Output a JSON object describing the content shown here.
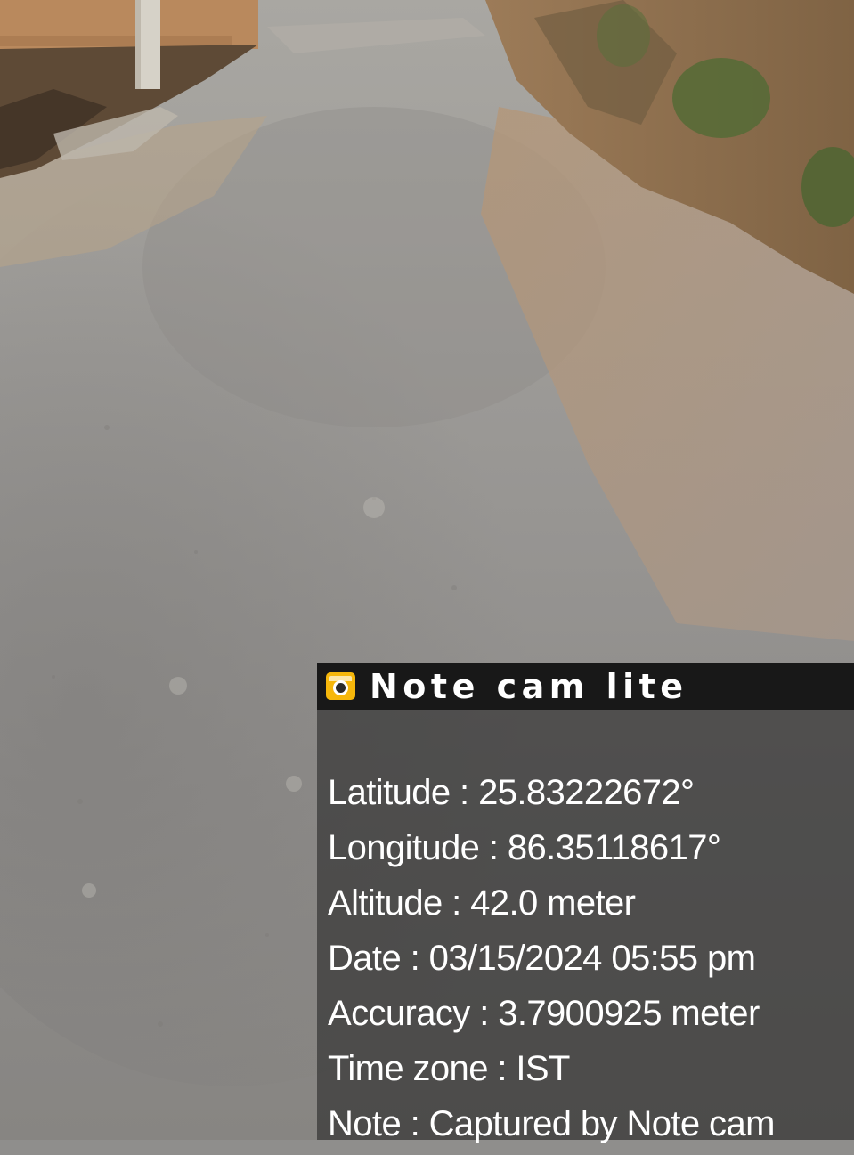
{
  "overlay": {
    "app_icon": "camera-app-icon",
    "app_name": "Note cam lite",
    "lines": [
      "Latitude : 25.83222672°",
      "Longitude : 86.35118617°",
      "Altitude : 42.0 meter",
      "Date : 03/15/2024 05:55 pm",
      "Accuracy : 3.7900925 meter",
      "Time zone : IST",
      "Note : Captured by Note cam"
    ]
  },
  "colors": {
    "header_bg": "#141414",
    "panel_bg": "#282828",
    "icon_accent": "#f6b70b",
    "text": "#ffffff"
  }
}
